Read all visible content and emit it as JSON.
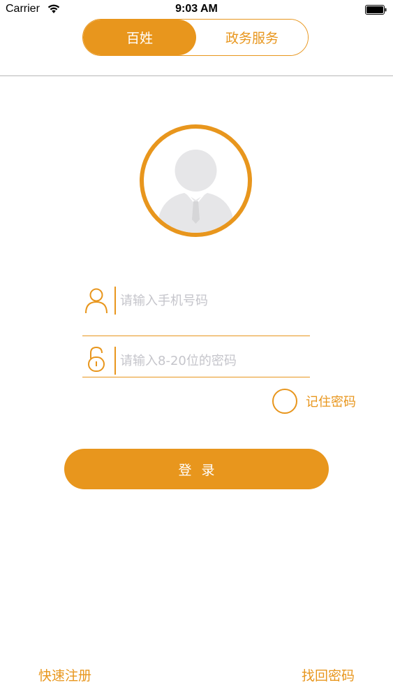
{
  "status_bar": {
    "carrier": "Carrier",
    "time": "9:03 AM"
  },
  "segment": {
    "tabs": [
      {
        "label": "百姓",
        "active": true
      },
      {
        "label": "政务服务",
        "active": false
      }
    ]
  },
  "form": {
    "phone_placeholder": "请输入手机号码",
    "password_placeholder": "请输入8-20位的密码",
    "remember_label": "记住密码",
    "login_label": "登录"
  },
  "footer": {
    "register_label": "快速注册",
    "forgot_label": "找回密码"
  },
  "colors": {
    "accent": "#e8961d",
    "placeholder": "#c5c5cb",
    "avatar_gray": "#e6e6e8"
  },
  "icons": [
    "wifi-icon",
    "battery-icon",
    "avatar-icon",
    "user-icon",
    "lock-icon"
  ]
}
